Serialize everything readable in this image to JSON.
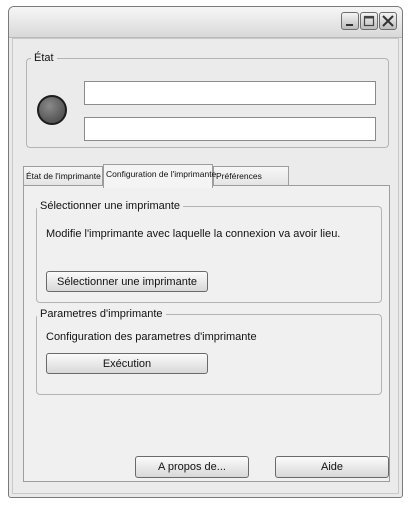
{
  "window": {
    "controls": [
      "minimize-icon",
      "maximize-icon",
      "close-icon"
    ]
  },
  "status_group": {
    "legend": "État",
    "field1": "",
    "field2": ""
  },
  "tabs": [
    {
      "label": "État de l'imprimante"
    },
    {
      "label": "Configuration de l'imprimante"
    },
    {
      "label": "Préférences"
    }
  ],
  "select_printer": {
    "legend": "Sélectionner une imprimante",
    "description": "Modifie l'imprimante avec laquelle la connexion va avoir lieu.",
    "button": "Sélectionner une imprimante"
  },
  "printer_params": {
    "legend": "Parametres d'imprimante",
    "description": "Configuration des parametres d'imprimante",
    "button": "Exécution"
  },
  "footer": {
    "about": "A propos de...",
    "help": "Aide"
  },
  "colors": {
    "window_bg": "#ebebeb",
    "border": "#9d9d9d",
    "led": "#5a5a5a"
  }
}
